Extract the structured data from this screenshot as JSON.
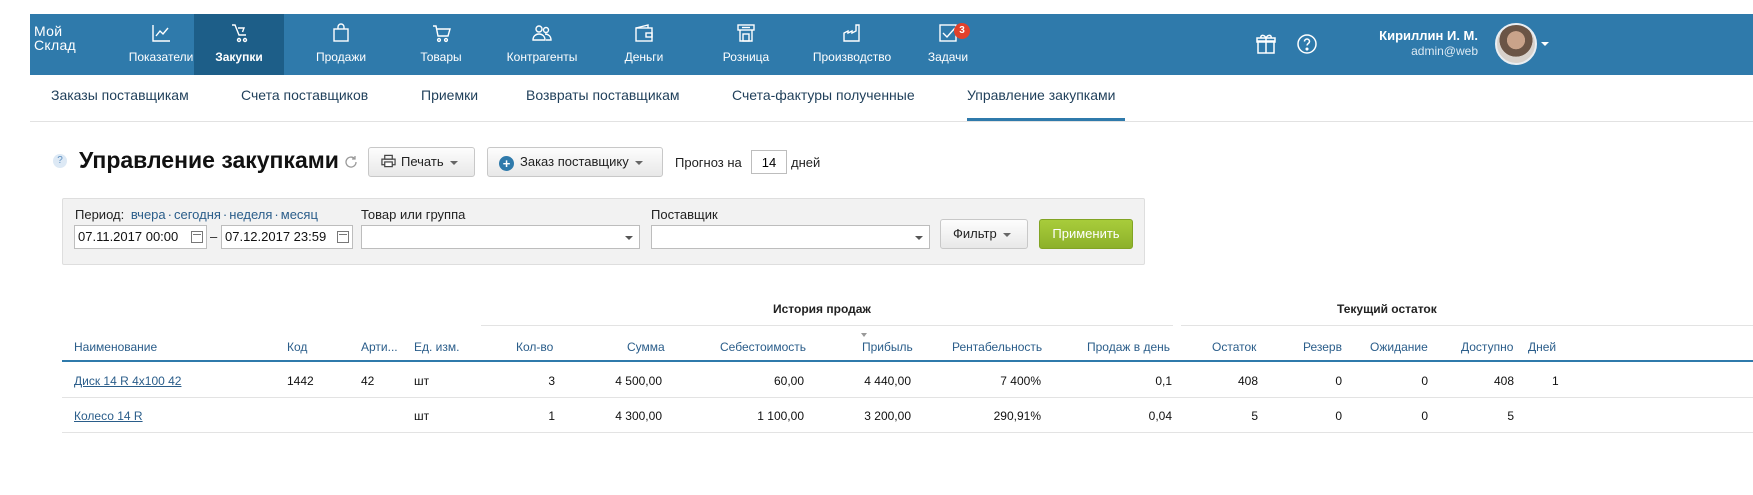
{
  "nav": {
    "logo_line1": "Мой",
    "logo_line2": "Склад",
    "items": [
      {
        "label": "Показатели",
        "icon": "chart-line-icon"
      },
      {
        "label": "Закупки",
        "icon": "purchases-icon"
      },
      {
        "label": "Продажи",
        "icon": "shopping-bag-icon"
      },
      {
        "label": "Товары",
        "icon": "cart-icon"
      },
      {
        "label": "Контрагенты",
        "icon": "people-icon"
      },
      {
        "label": "Деньги",
        "icon": "wallet-icon"
      },
      {
        "label": "Розница",
        "icon": "store-icon"
      },
      {
        "label": "Производство",
        "icon": "factory-icon"
      },
      {
        "label": "Задачи",
        "icon": "tasks-icon",
        "badge": "3"
      }
    ],
    "active_item": "Закупки",
    "user_name": "Кириллин И. М.",
    "user_login": "admin@web"
  },
  "subtabs": {
    "items": [
      {
        "label": "Заказы поставщикам"
      },
      {
        "label": "Счета поставщиков"
      },
      {
        "label": "Приемки"
      },
      {
        "label": "Возвраты поставщикам"
      },
      {
        "label": "Счета-фактуры полученные"
      },
      {
        "label": "Управление закупками"
      }
    ],
    "active": "Управление закупками"
  },
  "header": {
    "help_mark": "?",
    "title": "Управление закупками",
    "print_label": "Печать",
    "order_label": "Заказ поставщику",
    "forecast_prefix": "Прогноз на",
    "forecast_days": "14",
    "forecast_suffix": "дней"
  },
  "filter": {
    "period_label": "Период:",
    "period_links": [
      "вчера",
      "сегодня",
      "неделя",
      "месяц"
    ],
    "date_from": "07.11.2017 00:00",
    "date_to": "07.12.2017 23:59",
    "dash": "–",
    "product_label": "Товар или группа",
    "product_value": "",
    "supplier_label": "Поставщик",
    "supplier_value": "",
    "filter_button": "Фильтр",
    "apply_button": "Применить"
  },
  "table": {
    "group_sales": "История продаж",
    "group_stock": "Текущий остаток",
    "columns": [
      "Наименование",
      "Код",
      "Арти...",
      "Ед. изм.",
      "Кол-во",
      "Сумма",
      "Себестоимость",
      "Прибыль",
      "Рентабельность",
      "Продаж в день",
      "Остаток",
      "Резерв",
      "Ожидание",
      "Доступно",
      "Дней"
    ],
    "rows": [
      [
        "Диск 14 R 4x100 42",
        "1442",
        "42",
        "шт",
        "3",
        "4 500,00",
        "60,00",
        "4 440,00",
        "7 400%",
        "0,1",
        "408",
        "0",
        "0",
        "408",
        "1"
      ],
      [
        "Колесо 14 R",
        "",
        "",
        "шт",
        "1",
        "4 300,00",
        "1 100,00",
        "3 200,00",
        "290,91%",
        "0,04",
        "5",
        "0",
        "0",
        "5",
        ""
      ]
    ]
  }
}
